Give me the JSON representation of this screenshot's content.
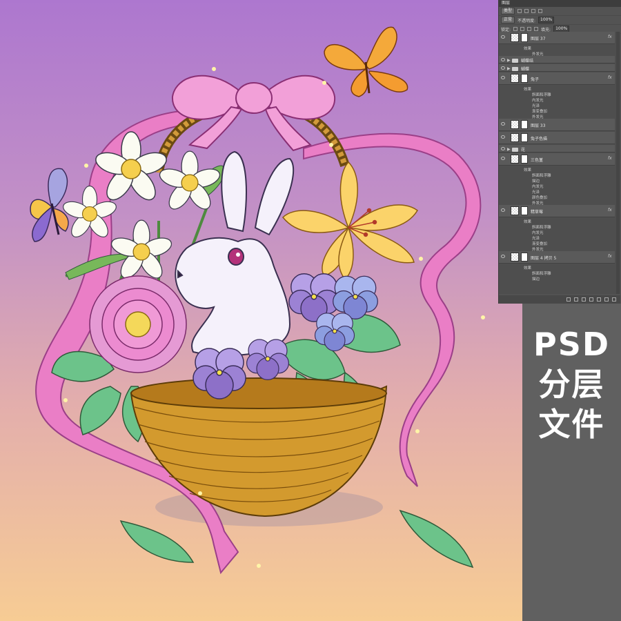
{
  "caption": {
    "line1": "PSD",
    "line2": "分层",
    "line3": "文件"
  },
  "colors": {
    "bg_top": "#ad77cf",
    "bg_bottom": "#f7cc94",
    "ribbon": "#ea7ec6",
    "basket": "#c9861f",
    "panel": "#535353",
    "strip": "#606060"
  },
  "layers_panel": {
    "title": "图层",
    "filter_kind": "类型",
    "blend_mode": "正常",
    "opacity_label": "不透明度:",
    "opacity_value": "100%",
    "lock_label": "锁定:",
    "fill_label": "填充:",
    "fill_value": "100%",
    "layers": [
      {
        "name": "图层 37",
        "kind": "layer",
        "fx": "fx"
      },
      {
        "name": "效果",
        "kind": "effect"
      },
      {
        "name": "外发光",
        "kind": "effect-sub"
      },
      {
        "name": "蝴蝶结",
        "kind": "group"
      },
      {
        "name": "蝴蝶",
        "kind": "group"
      },
      {
        "name": "兔子",
        "kind": "layer",
        "fx": "fx"
      },
      {
        "name": "效果",
        "kind": "effect"
      },
      {
        "name": "斜面和浮雕",
        "kind": "effect-sub"
      },
      {
        "name": "内发光",
        "kind": "effect-sub"
      },
      {
        "name": "光泽",
        "kind": "effect-sub"
      },
      {
        "name": "渐变叠加",
        "kind": "effect-sub"
      },
      {
        "name": "外发光",
        "kind": "effect-sub"
      },
      {
        "name": "图层 33",
        "kind": "layer"
      },
      {
        "name": "兔子色描",
        "kind": "layer"
      },
      {
        "name": "花",
        "kind": "group"
      },
      {
        "name": "三色堇",
        "kind": "layer",
        "fx": "fx"
      },
      {
        "name": "效果",
        "kind": "effect"
      },
      {
        "name": "斜面和浮雕",
        "kind": "effect-sub"
      },
      {
        "name": "描边",
        "kind": "effect-sub"
      },
      {
        "name": "内发光",
        "kind": "effect-sub"
      },
      {
        "name": "光泽",
        "kind": "effect-sub"
      },
      {
        "name": "颜色叠加",
        "kind": "effect-sub"
      },
      {
        "name": "外发光",
        "kind": "effect-sub"
      },
      {
        "name": "精草莓",
        "kind": "layer",
        "fx": "fx"
      },
      {
        "name": "效果",
        "kind": "effect"
      },
      {
        "name": "斜面和浮雕",
        "kind": "effect-sub"
      },
      {
        "name": "内发光",
        "kind": "effect-sub"
      },
      {
        "name": "光泽",
        "kind": "effect-sub"
      },
      {
        "name": "渐变叠加",
        "kind": "effect-sub"
      },
      {
        "name": "外发光",
        "kind": "effect-sub"
      },
      {
        "name": "图层 4 拷贝 5",
        "kind": "layer",
        "fx": "fx"
      },
      {
        "name": "效果",
        "kind": "effect"
      },
      {
        "name": "斜面和浮雕",
        "kind": "effect-sub"
      },
      {
        "name": "描边",
        "kind": "effect-sub"
      }
    ]
  }
}
